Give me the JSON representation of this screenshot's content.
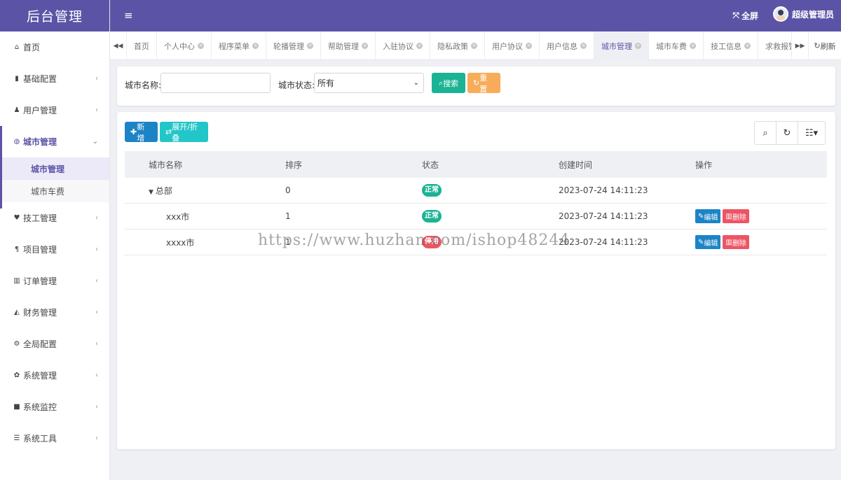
{
  "app": {
    "title": "后台管理"
  },
  "header": {
    "menu_icon": "≡",
    "fullscreen_label": "全屏",
    "user_name": "超级管理员"
  },
  "sidebar": {
    "items": [
      {
        "icon": "home-icon",
        "glyph": "⌂",
        "label": "首页",
        "has_children": false
      },
      {
        "icon": "bookmark-icon",
        "glyph": "▮",
        "label": "基础配置",
        "has_children": true
      },
      {
        "icon": "user-icon",
        "glyph": "♟",
        "label": "用户管理",
        "has_children": true
      },
      {
        "icon": "globe-icon",
        "glyph": "◍",
        "label": "城市管理",
        "has_children": true,
        "active": true,
        "children": [
          {
            "label": "城市管理",
            "active": true
          },
          {
            "label": "城市车费"
          }
        ]
      },
      {
        "icon": "heart-icon",
        "glyph": "♥",
        "label": "技工管理",
        "has_children": true
      },
      {
        "icon": "paragraph-icon",
        "glyph": "¶",
        "label": "项目管理",
        "has_children": true
      },
      {
        "icon": "bar-chart-icon",
        "glyph": "▥",
        "label": "订单管理",
        "has_children": true
      },
      {
        "icon": "area-chart-icon",
        "glyph": "◭",
        "label": "财务管理",
        "has_children": true
      },
      {
        "icon": "cogs-icon",
        "glyph": "⚙",
        "label": "全局配置",
        "has_children": true
      },
      {
        "icon": "gear-icon",
        "glyph": "✿",
        "label": "系统管理",
        "has_children": true
      },
      {
        "icon": "video-icon",
        "glyph": "■",
        "label": "系统监控",
        "has_children": true
      },
      {
        "icon": "bars-icon",
        "glyph": "☰",
        "label": "系统工具",
        "has_children": true
      }
    ]
  },
  "tabs": {
    "refresh_label": "刷新",
    "items": [
      {
        "label": "首页",
        "closable": false
      },
      {
        "label": "个人中心",
        "closable": true
      },
      {
        "label": "程序菜单",
        "closable": true
      },
      {
        "label": "轮播管理",
        "closable": true
      },
      {
        "label": "帮助管理",
        "closable": true
      },
      {
        "label": "入驻协议",
        "closable": true
      },
      {
        "label": "隐私政策",
        "closable": true
      },
      {
        "label": "用户协议",
        "closable": true
      },
      {
        "label": "用户信息",
        "closable": true
      },
      {
        "label": "城市管理",
        "closable": true,
        "active": true
      },
      {
        "label": "城市车费",
        "closable": true
      },
      {
        "label": "技工信息",
        "closable": true
      },
      {
        "label": "求救报警",
        "closable": true
      }
    ]
  },
  "search": {
    "name_label": "城市名称:",
    "name_value": "",
    "status_label": "城市状态:",
    "status_value": "所有",
    "search_button": "搜索",
    "reset_button": "重置"
  },
  "toolbar": {
    "add_button": "新增",
    "toggle_button": "展开/折叠"
  },
  "table": {
    "columns": [
      "城市名称",
      "排序",
      "状态",
      "创建时间",
      "操作"
    ],
    "rows": [
      {
        "name": "总部",
        "level": 0,
        "expanded": true,
        "sort": "0",
        "status": "正常",
        "status_type": "ok",
        "created": "2023-07-24 14:11:23",
        "actions": []
      },
      {
        "name": "xxx市",
        "level": 1,
        "sort": "1",
        "status": "正常",
        "status_type": "ok",
        "created": "2023-07-24 14:11:23",
        "actions": [
          "编辑",
          "删除"
        ]
      },
      {
        "name": "xxxx市",
        "level": 1,
        "sort": "1",
        "status": "停用",
        "status_type": "off",
        "created": "2023-07-24 14:11:23",
        "actions": [
          "编辑",
          "删除"
        ]
      }
    ]
  },
  "watermark": "https://www.huzhan.com/ishop48244",
  "colors": {
    "primary": "#5b54a6",
    "success": "#1ab394",
    "warning": "#f8ac59",
    "info": "#1c84c6",
    "cyan": "#23c6c8",
    "danger": "#ed5565"
  }
}
